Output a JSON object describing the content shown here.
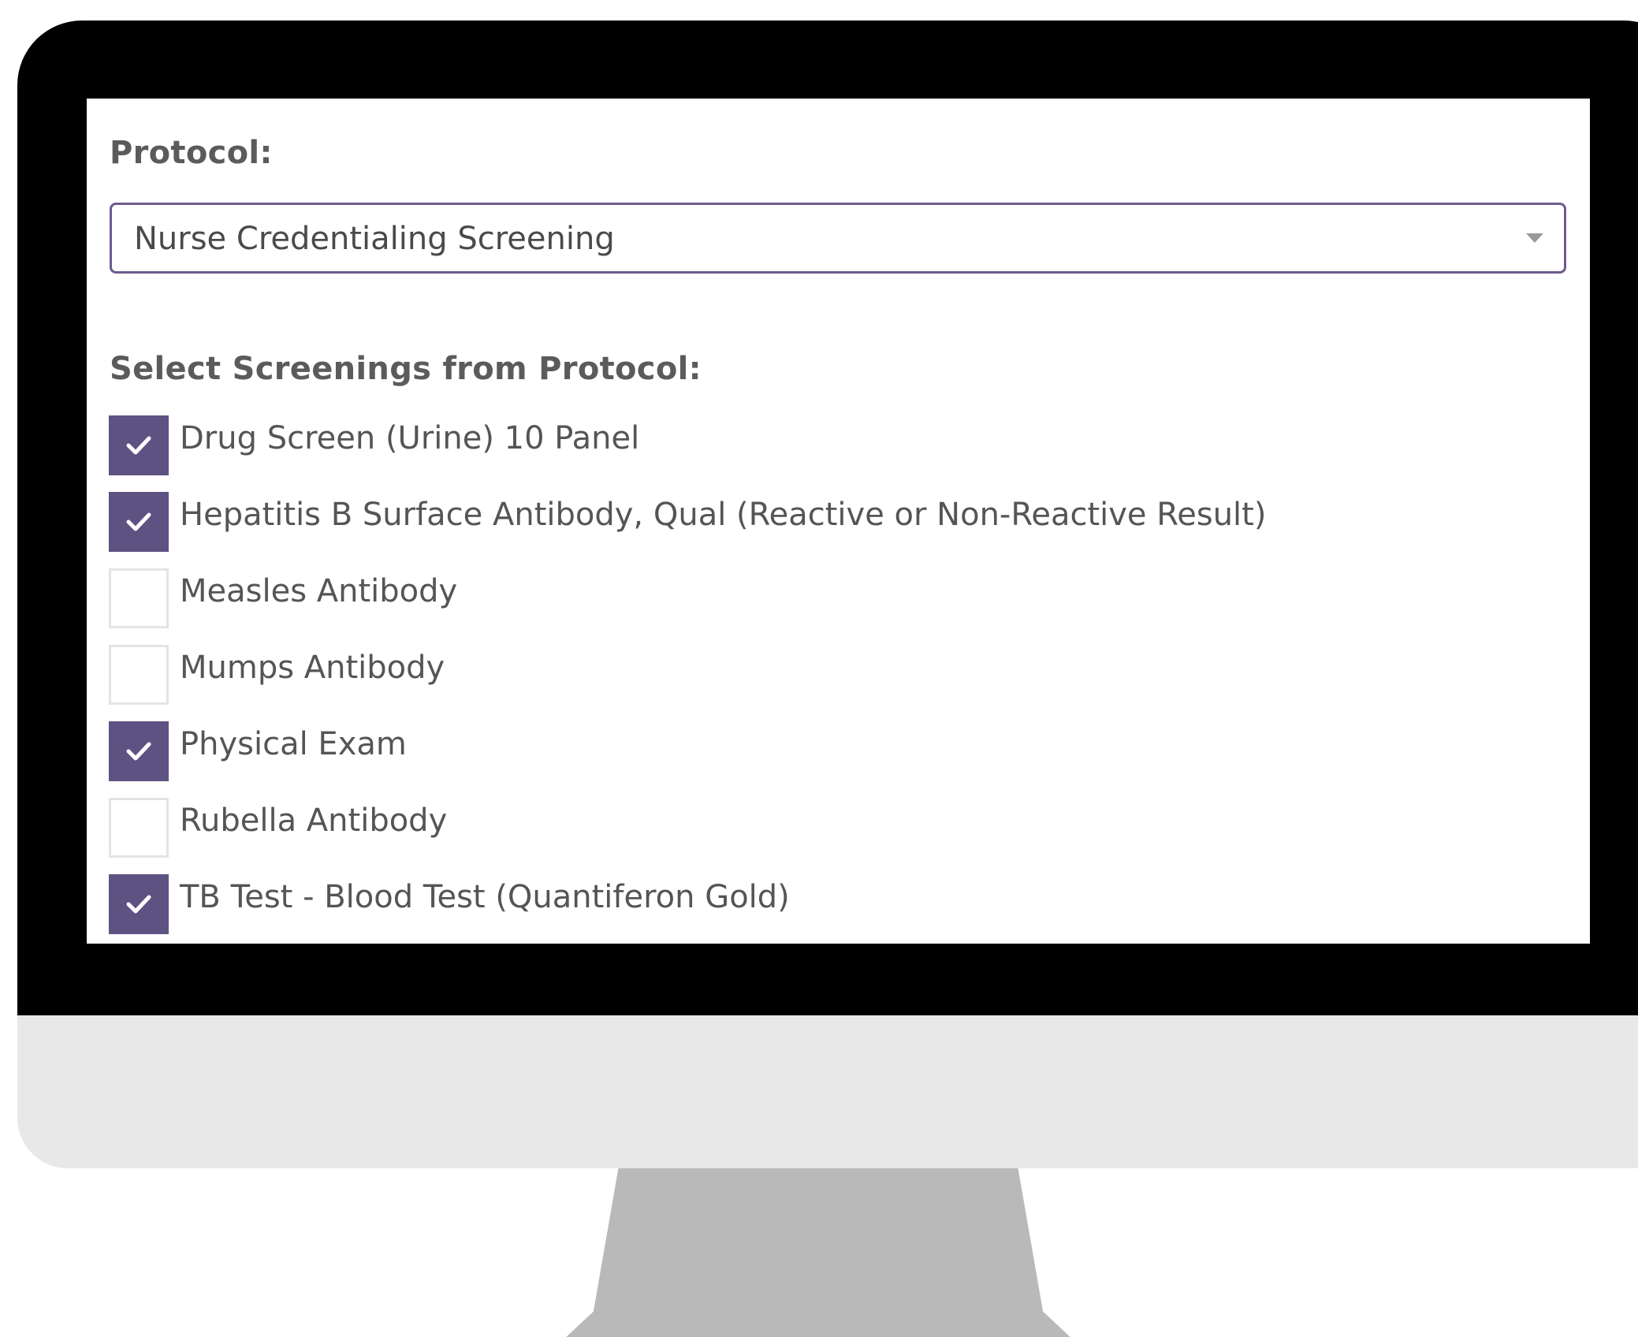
{
  "colors": {
    "accent": "#5e5282",
    "dropdown_border": "#6d5b8e",
    "bezel": "#000000",
    "chin": "#e8e8e8",
    "stand": "#b9b9b9",
    "text": "#555555"
  },
  "form": {
    "protocol_label": "Protocol:",
    "protocol_selected": "Nurse Credentialing Screening",
    "screenings_label": "Select Screenings from Protocol:",
    "screenings": [
      {
        "label": "Drug Screen (Urine) 10 Panel",
        "checked": true
      },
      {
        "label": "Hepatitis B Surface Antibody, Qual (Reactive or Non-Reactive Result)",
        "checked": true
      },
      {
        "label": "Measles Antibody",
        "checked": false
      },
      {
        "label": "Mumps Antibody",
        "checked": false
      },
      {
        "label": "Physical Exam",
        "checked": true
      },
      {
        "label": "Rubella Antibody",
        "checked": false
      },
      {
        "label": "TB Test - Blood Test (Quantiferon Gold)",
        "checked": true
      }
    ]
  },
  "icons": {
    "checkmark": "checkmark-icon",
    "dropdown_arrow": "caret-down-icon"
  }
}
